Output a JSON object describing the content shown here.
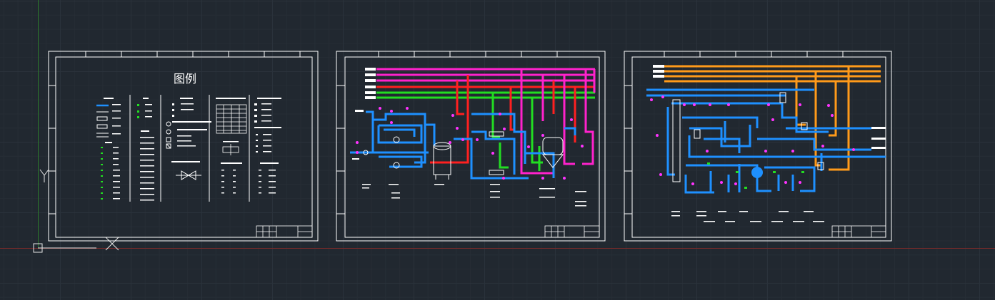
{
  "sheet1": {
    "title": "图例"
  },
  "colors": {
    "background": "#212830",
    "sheet_border": "#ffffff",
    "pipe_blue": "#1e90ff",
    "pipe_magenta": "#ff22cc",
    "pipe_green": "#22dd22",
    "pipe_red": "#ff2020",
    "pipe_orange": "#ff9a1a",
    "valve_marker": "#ff33ff"
  }
}
